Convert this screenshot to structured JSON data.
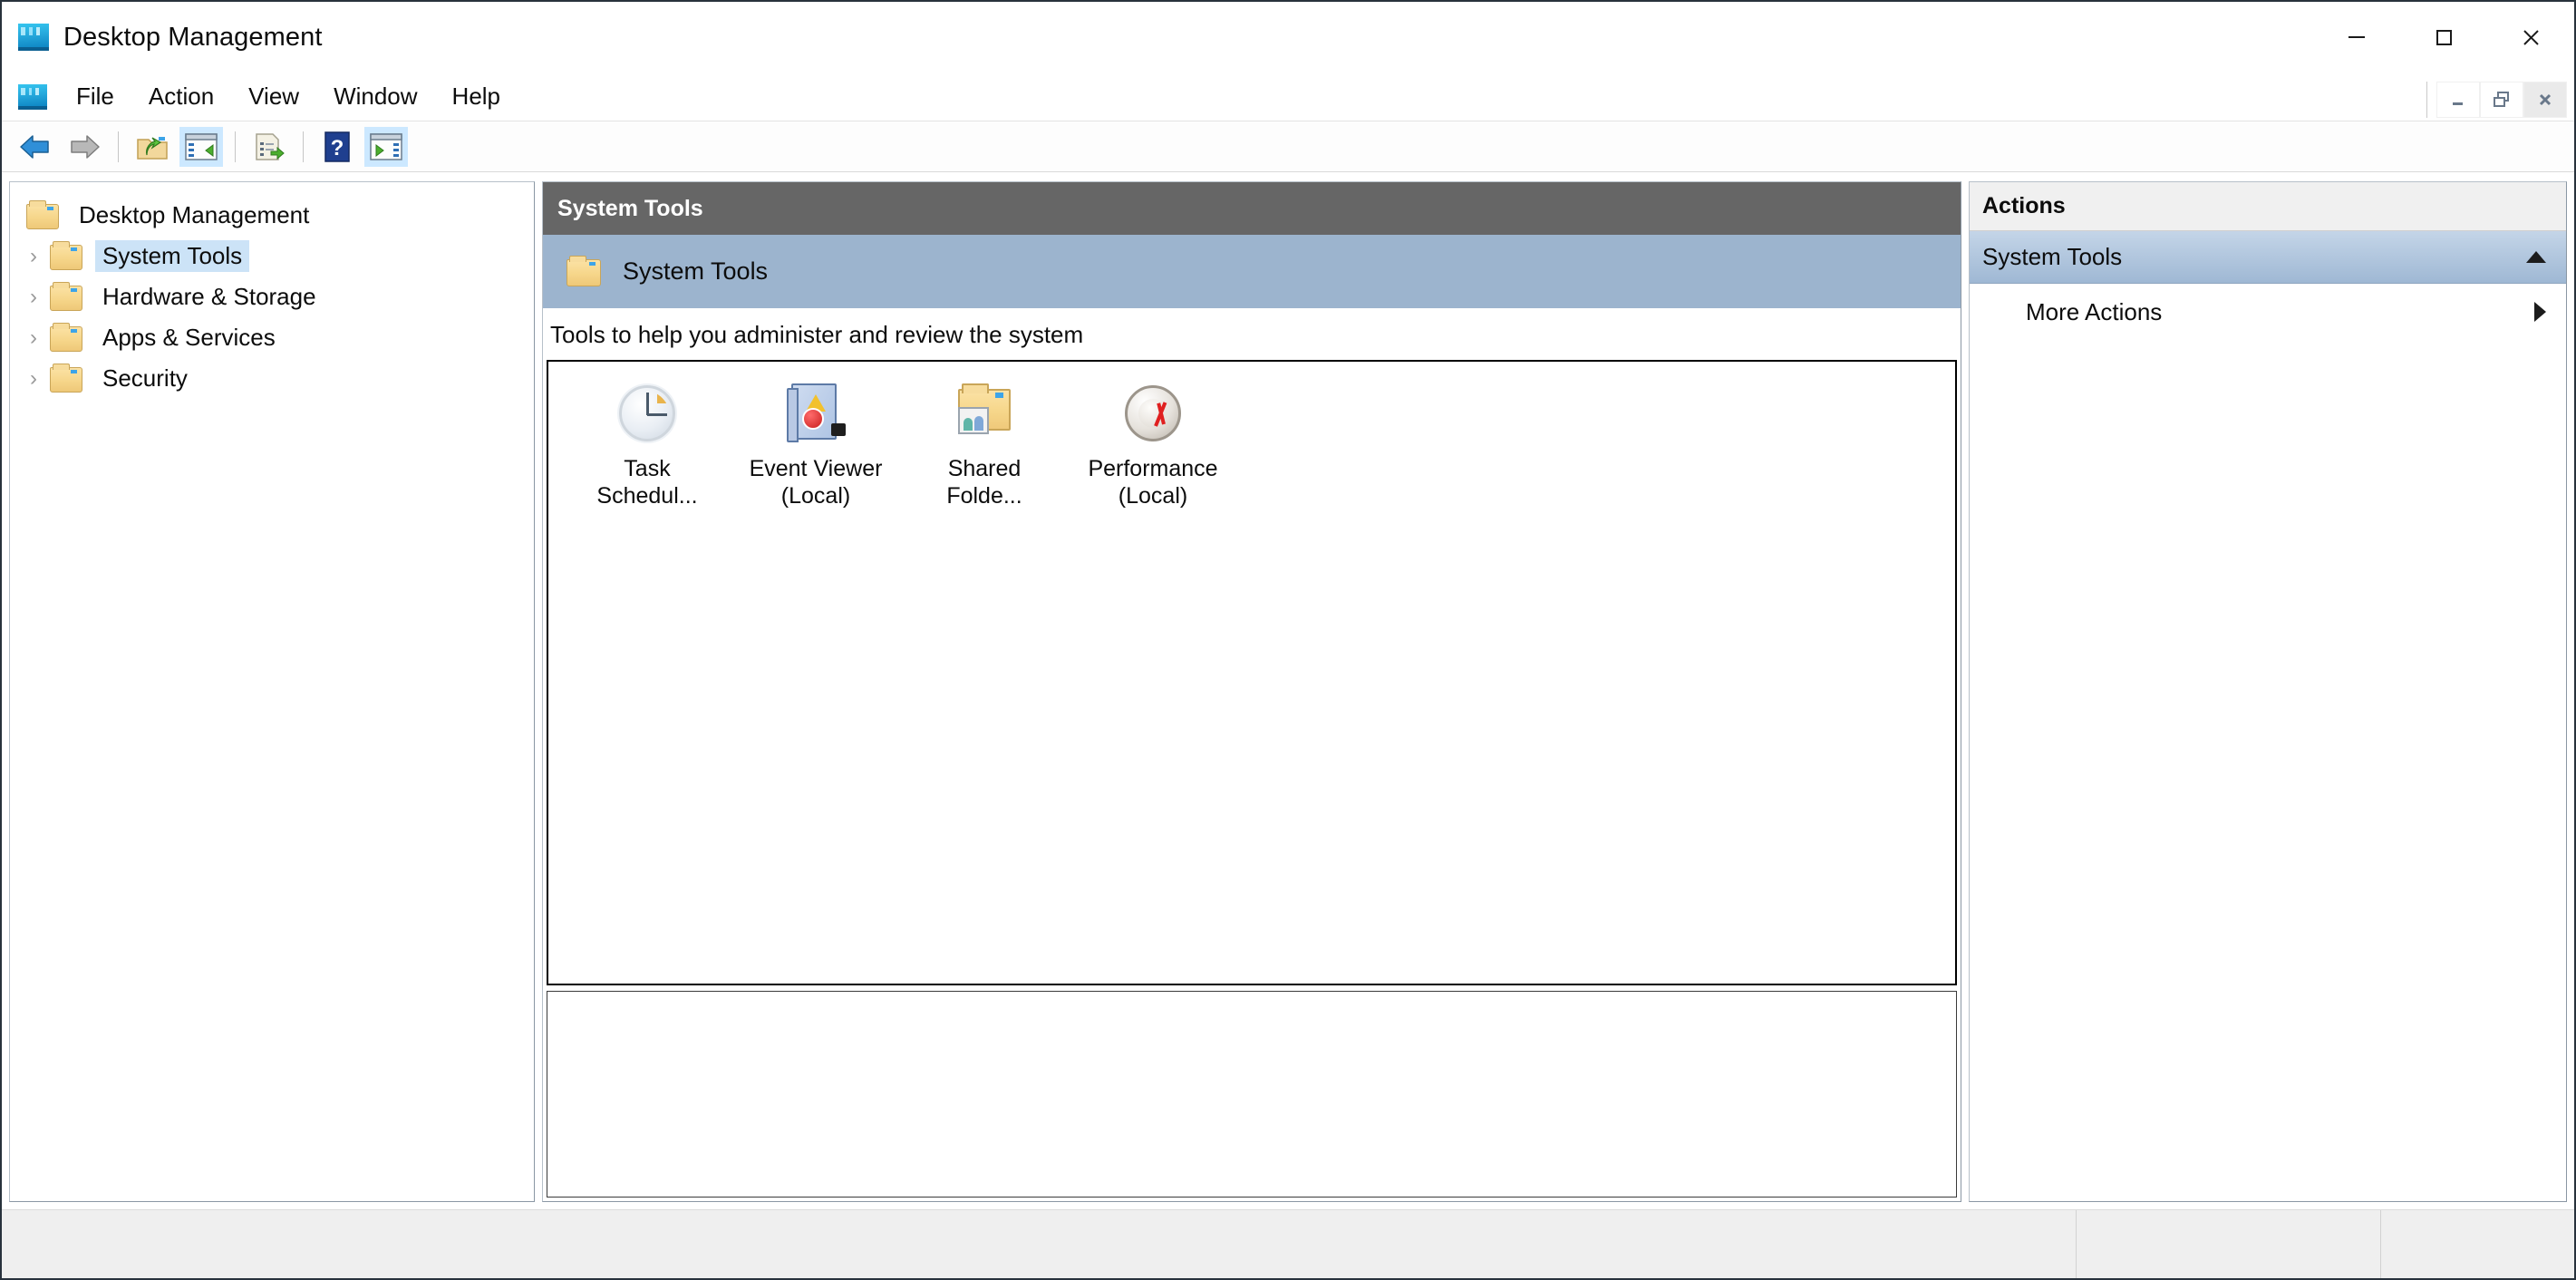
{
  "window": {
    "title": "Desktop Management",
    "icon": "console-icon",
    "controls": [
      {
        "name": "minimize-button",
        "glyph": "minimize"
      },
      {
        "name": "maximize-button",
        "glyph": "maximize"
      },
      {
        "name": "close-button",
        "glyph": "close"
      }
    ],
    "mdi_controls": [
      {
        "name": "mdi-minimize-button",
        "glyph": "minimize"
      },
      {
        "name": "mdi-restore-button",
        "glyph": "restore"
      },
      {
        "name": "mdi-close-button",
        "glyph": "close"
      }
    ]
  },
  "menubar": {
    "items": [
      {
        "label": "File",
        "name": "menu-file"
      },
      {
        "label": "Action",
        "name": "menu-action"
      },
      {
        "label": "View",
        "name": "menu-view"
      },
      {
        "label": "Window",
        "name": "menu-window"
      },
      {
        "label": "Help",
        "name": "menu-help"
      }
    ]
  },
  "toolbar": {
    "buttons": [
      {
        "name": "back-button",
        "icon": "back-arrow-icon",
        "selected": false
      },
      {
        "name": "forward-button",
        "icon": "forward-arrow-icon",
        "selected": false
      },
      {
        "name": "up-one-level-button",
        "icon": "folder-up-icon",
        "selected": false
      },
      {
        "name": "show-hide-console-tree-button",
        "icon": "console-tree-icon",
        "selected": true
      },
      {
        "name": "export-list-button",
        "icon": "export-list-icon",
        "selected": false
      },
      {
        "name": "help-button",
        "icon": "help-question-icon",
        "selected": false
      },
      {
        "name": "show-hide-action-pane-button",
        "icon": "action-pane-icon",
        "selected": true
      }
    ]
  },
  "tree": {
    "root": {
      "label": "Desktop Management",
      "icon": "folder-icon"
    },
    "items": [
      {
        "label": "System Tools",
        "icon": "folder-icon",
        "expander": "chevron-right-icon",
        "selected": true
      },
      {
        "label": "Hardware & Storage",
        "icon": "folder-icon",
        "expander": "chevron-right-icon",
        "selected": false
      },
      {
        "label": "Apps & Services",
        "icon": "folder-icon",
        "expander": "chevron-right-icon",
        "selected": false
      },
      {
        "label": "Security",
        "icon": "folder-icon",
        "expander": "chevron-right-icon",
        "selected": false
      }
    ]
  },
  "main": {
    "header_title": "System Tools",
    "banner_title": "System Tools",
    "banner_icon": "folder-icon",
    "description": "Tools to help you administer and review the system",
    "items": [
      {
        "name": "task-scheduler-item",
        "icon": "clock-icon",
        "line1": "Task",
        "line2": "Schedul..."
      },
      {
        "name": "event-viewer-item",
        "icon": "event-log-icon",
        "line1": "Event Viewer",
        "line2": "(Local)"
      },
      {
        "name": "shared-folders-item",
        "icon": "shared-folder-icon",
        "line1": "Shared",
        "line2": "Folde..."
      },
      {
        "name": "performance-item",
        "icon": "gauge-icon",
        "line1": "Performance",
        "line2": "(Local)"
      }
    ]
  },
  "actions": {
    "header": "Actions",
    "group": {
      "label": "System Tools",
      "collapse_icon": "triangle-up-icon"
    },
    "items": [
      {
        "label": "More Actions",
        "submenu_icon": "triangle-right-icon",
        "name": "more-actions-item"
      }
    ]
  },
  "status": {
    "segment_1": "",
    "segment_2": "",
    "segment_3": ""
  },
  "colors": {
    "header_bar": "#666666",
    "banner": "#9cb4ce",
    "selection": "#cce3f7",
    "toolbar_selected": "#cce8ff",
    "action_group": "#9fb8d4"
  }
}
